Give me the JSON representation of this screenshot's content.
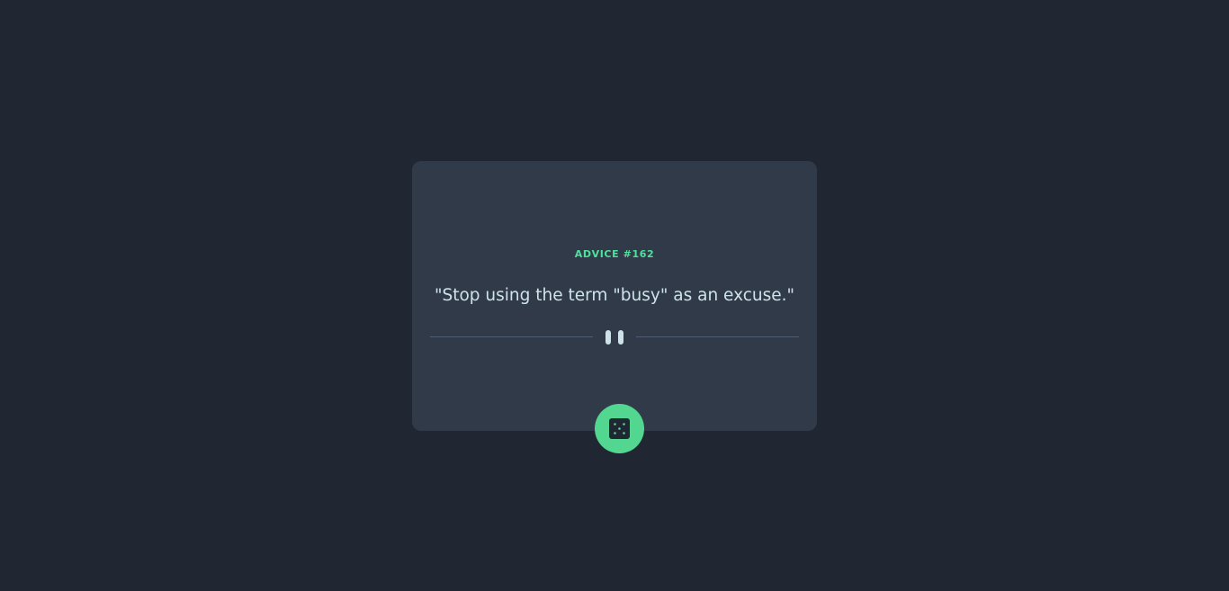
{
  "card": {
    "advice_label": "ADVICE #162",
    "advice_text": "\"Stop using the term \"busy\" as an excuse.\""
  },
  "icons": {
    "divider": "pause-icon",
    "button": "dice-icon"
  },
  "colors": {
    "background": "#202632",
    "card": "#313a48",
    "accent": "#53ffaa",
    "button": "#53d690",
    "text": "#cee3e9"
  }
}
